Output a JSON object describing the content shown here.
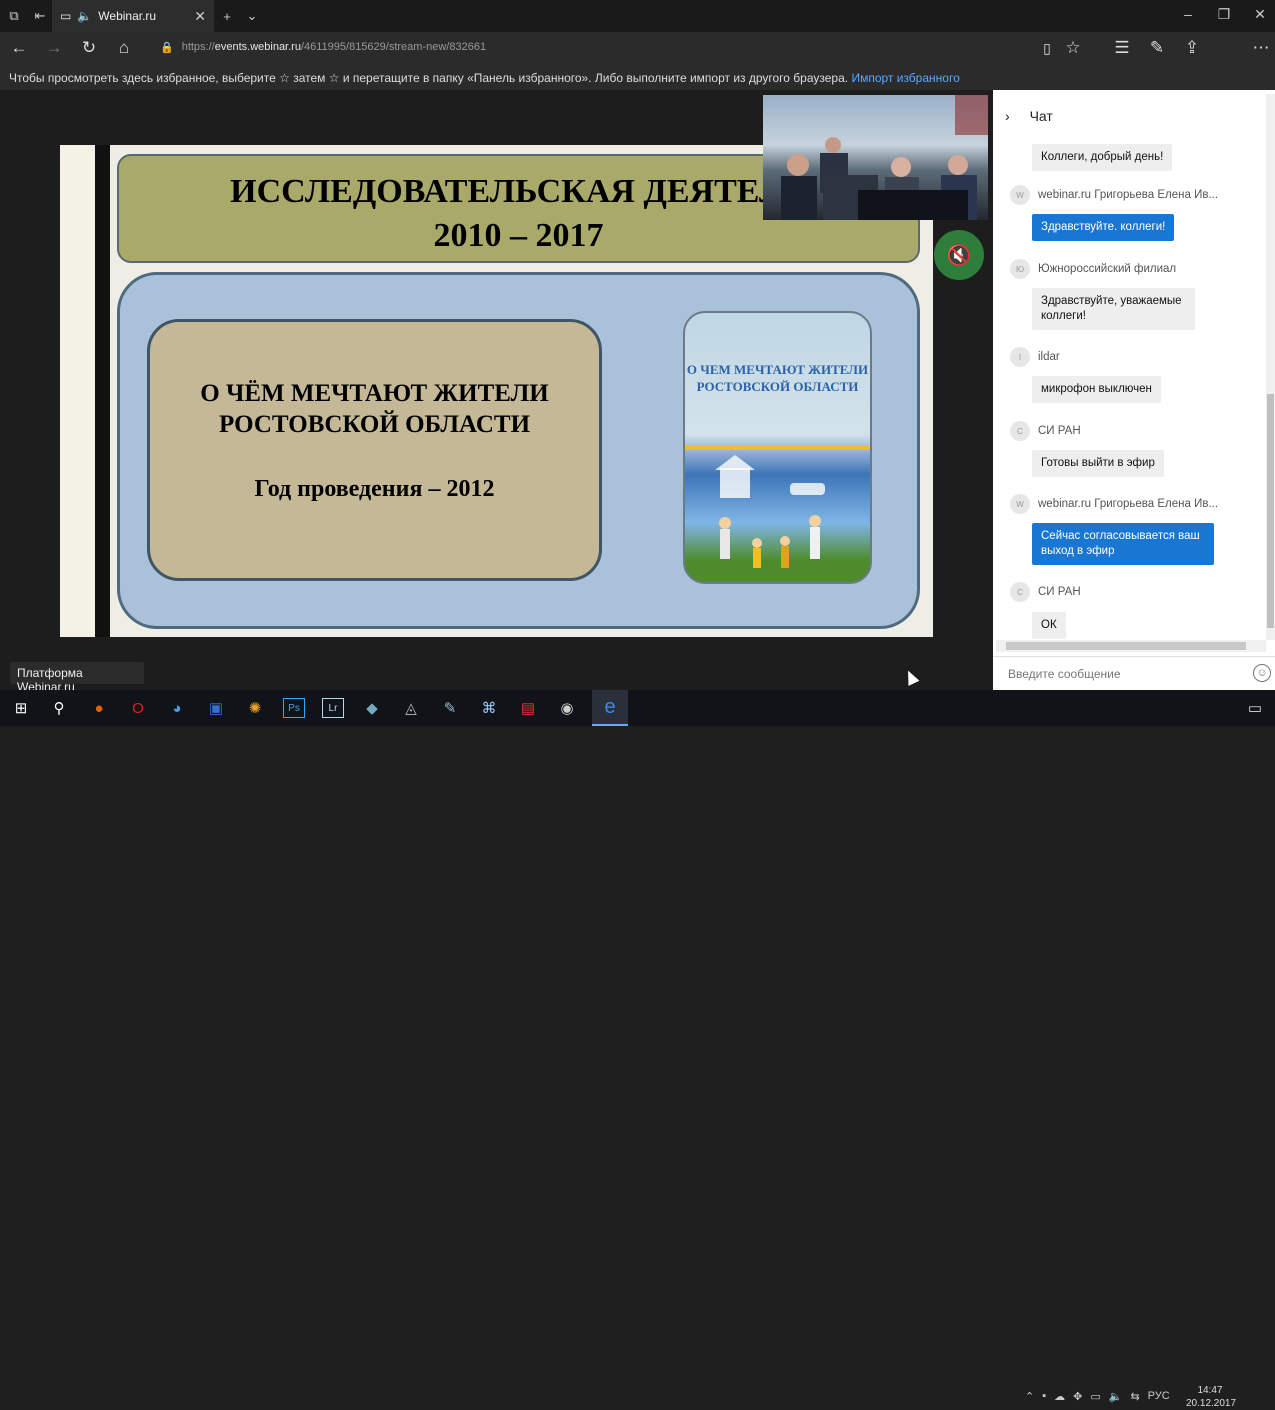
{
  "browser": {
    "tab_title": "Webinar.ru",
    "url_prefix": "https://",
    "url_host": "events.webinar.ru",
    "url_path": "/4611995/815629/stream-new/832661",
    "favorites_text": "Чтобы просмотреть здесь избранное, выберите  ☆  затем ☆ и перетащите в папку «Панель избранного». Либо выполните импорт из другого браузера.",
    "favorites_link": "Импорт избранного"
  },
  "slide": {
    "title_line1": "ИССЛЕДОВАТЕЛЬСКАЯ ДЕЯТЕЛЬ",
    "title_line2": "2010 – 2017",
    "survey_line1": "О ЧЁМ МЕЧТАЮТ ЖИТЕЛИ",
    "survey_line2": "РОСТОВСКОЙ ОБЛАСТИ",
    "survey_year": "Год проведения – 2012",
    "book_line1": "О ЧЕМ МЕЧТАЮТ ЖИТЕЛИ",
    "book_line2": "РОСТОВСКОЙ ОБЛАСТИ"
  },
  "platform_label": "Платформа Webinar.ru",
  "chat": {
    "header": "Чат",
    "input_placeholder": "Введите сообщение",
    "messages": [
      {
        "author": "",
        "avatar": "",
        "text": "Коллеги, добрый день!",
        "style": "grey"
      },
      {
        "author": "webinar.ru Григорьева Елена Ив...",
        "avatar": "W",
        "text": "Здравствуйте. коллеги!",
        "style": "blue"
      },
      {
        "author": "Южнороссийский филиал",
        "avatar": "Ю",
        "text": "Здравствуйте, уважаемые коллеги!",
        "style": "grey"
      },
      {
        "author": "ildar",
        "avatar": "I",
        "text": "микрофон выключен",
        "style": "grey"
      },
      {
        "author": "СИ РАН",
        "avatar": "С",
        "text": "Готовы выйти в эфир",
        "style": "grey"
      },
      {
        "author": "webinar.ru Григорьева Елена Ив...",
        "avatar": "W",
        "text": "Сейчас согласовывается ваш выход в эфир",
        "style": "blue"
      },
      {
        "author": "СИ РАН",
        "avatar": "С",
        "text": "ОК",
        "style": "grey"
      }
    ]
  },
  "taskbar": {
    "language": "РУС",
    "time": "14:47",
    "date": "20.12.2017"
  },
  "colors": {
    "accent_blue": "#1976d2",
    "mute_green": "#2e7d3a",
    "title_olive": "#a9a96a"
  }
}
